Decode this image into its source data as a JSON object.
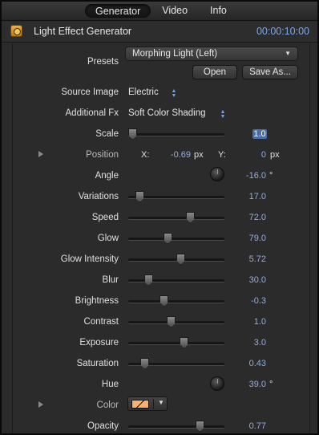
{
  "tabs": [
    {
      "label": "Generator",
      "active": true
    },
    {
      "label": "Video",
      "active": false
    },
    {
      "label": "Info",
      "active": false
    }
  ],
  "header": {
    "title": "Light Effect Generator",
    "timecode": "00:00:10:00",
    "icon": "generator-icon"
  },
  "presets": {
    "label": "Presets",
    "selected": "Morphing Light (Left)",
    "open_label": "Open",
    "save_as_label": "Save As..."
  },
  "source_image": {
    "label": "Source Image",
    "value": "Electric"
  },
  "additional_fx": {
    "label": "Additional Fx",
    "value": "Soft Color Shading"
  },
  "scale": {
    "label": "Scale",
    "value": "1.0",
    "level": 0.0
  },
  "position": {
    "label": "Position",
    "x_label": "X:",
    "x_value": "-0.69",
    "x_unit": "px",
    "y_label": "Y:",
    "y_value": "0",
    "y_unit": "px"
  },
  "angle": {
    "label": "Angle",
    "value": "-16.0",
    "unit": "°"
  },
  "sliders": [
    {
      "key": "variations",
      "label": "Variations",
      "value": "17.0",
      "level": 0.08
    },
    {
      "key": "speed",
      "label": "Speed",
      "value": "72.0",
      "level": 0.66
    },
    {
      "key": "glow",
      "label": "Glow",
      "value": "79.0",
      "level": 0.4
    },
    {
      "key": "glow-intensity",
      "label": "Glow Intensity",
      "value": "5.72",
      "level": 0.55
    },
    {
      "key": "blur",
      "label": "Blur",
      "value": "30.0",
      "level": 0.18
    },
    {
      "key": "brightness",
      "label": "Brightness",
      "value": "-0.3",
      "level": 0.36
    },
    {
      "key": "contrast",
      "label": "Contrast",
      "value": "1.0",
      "level": 0.44
    },
    {
      "key": "exposure",
      "label": "Exposure",
      "value": "3.0",
      "level": 0.59
    },
    {
      "key": "saturation",
      "label": "Saturation",
      "value": "0.43",
      "level": 0.14
    }
  ],
  "hue": {
    "label": "Hue",
    "value": "39.0",
    "unit": "°"
  },
  "color": {
    "label": "Color",
    "swatch": "#f7b070"
  },
  "opacity": {
    "label": "Opacity",
    "value": "0.77",
    "level": 0.77
  },
  "colors": {
    "accent_value": "#8eaee0",
    "selected_bg": "#4a6ea8",
    "timecode": "#7fa8e6"
  }
}
